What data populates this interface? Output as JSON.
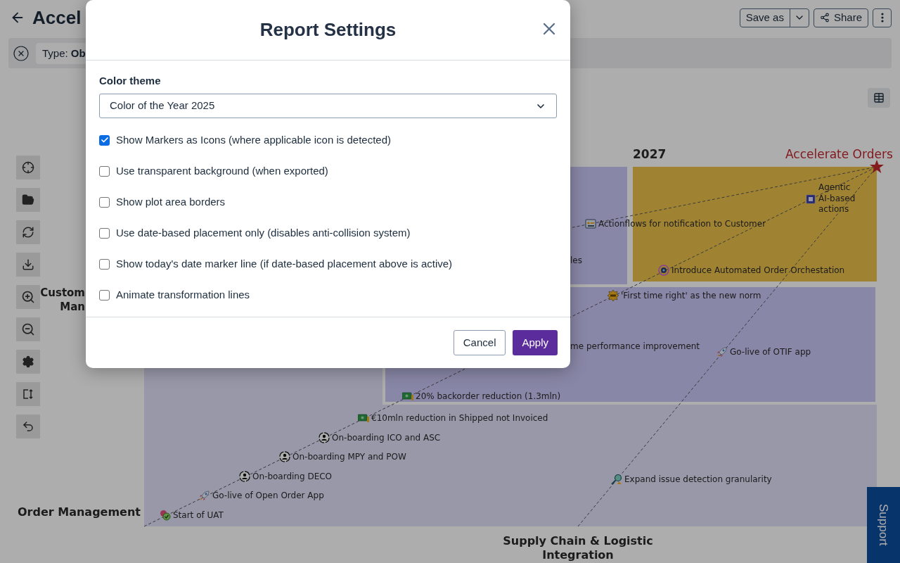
{
  "header": {
    "title": "Accel",
    "save_button": "Save as",
    "share_button": "Share"
  },
  "filter_bar": {
    "chip": "Type: **Ob**"
  },
  "chart": {
    "year_label": "2027",
    "goal": "Accelerate Orders",
    "row_labels": [
      {
        "lines": [
          "Custom",
          "Man"
        ]
      },
      {
        "lines": [
          "Order Management"
        ]
      }
    ],
    "column_label": [
      "Supply Chain & Logistic",
      "Integration"
    ],
    "milestones": [
      {
        "label": "Agentic AI-based actions"
      },
      {
        "label": "Actionflows for notification to Customer"
      },
      {
        "label": "les"
      },
      {
        "label": "Introduce Automated Order Orchestation"
      },
      {
        "label": "'First time right' as the new norm"
      },
      {
        "label": "me performance improvement"
      },
      {
        "label": "Go-live of OTIF app"
      },
      {
        "label": "20% backorder reduction (1.3mln)"
      },
      {
        "label": "€10mln reduction in Shipped not Invoiced"
      },
      {
        "label": "On-boarding ICO and ASC"
      },
      {
        "label": "On-boarding MPY and POW"
      },
      {
        "label": "On-boarding DECO"
      },
      {
        "label": "Expand issue detection granularity"
      },
      {
        "label": "Go-live of Open Order App"
      },
      {
        "label": "Start of UAT"
      }
    ]
  },
  "support_tab": "Support",
  "dialog": {
    "title": "Report Settings",
    "field_label": "Color theme",
    "select_value": "Color of the Year 2025",
    "options": [
      {
        "label": "Show Markers as Icons (where applicable icon is detected)",
        "checked": true
      },
      {
        "label": "Use transparent background (when exported)",
        "checked": false
      },
      {
        "label": "Show plot area borders",
        "checked": false
      },
      {
        "label": "Use date-based placement only (disables anti-collision system)",
        "checked": false
      },
      {
        "label": "Show today's date marker line (if date-based placement above is active)",
        "checked": false
      },
      {
        "label": "Animate transformation lines",
        "checked": false
      }
    ],
    "buttons": [
      {
        "label": "Cancel",
        "kind": "secondary"
      },
      {
        "label": "Apply",
        "kind": "primary"
      }
    ]
  }
}
